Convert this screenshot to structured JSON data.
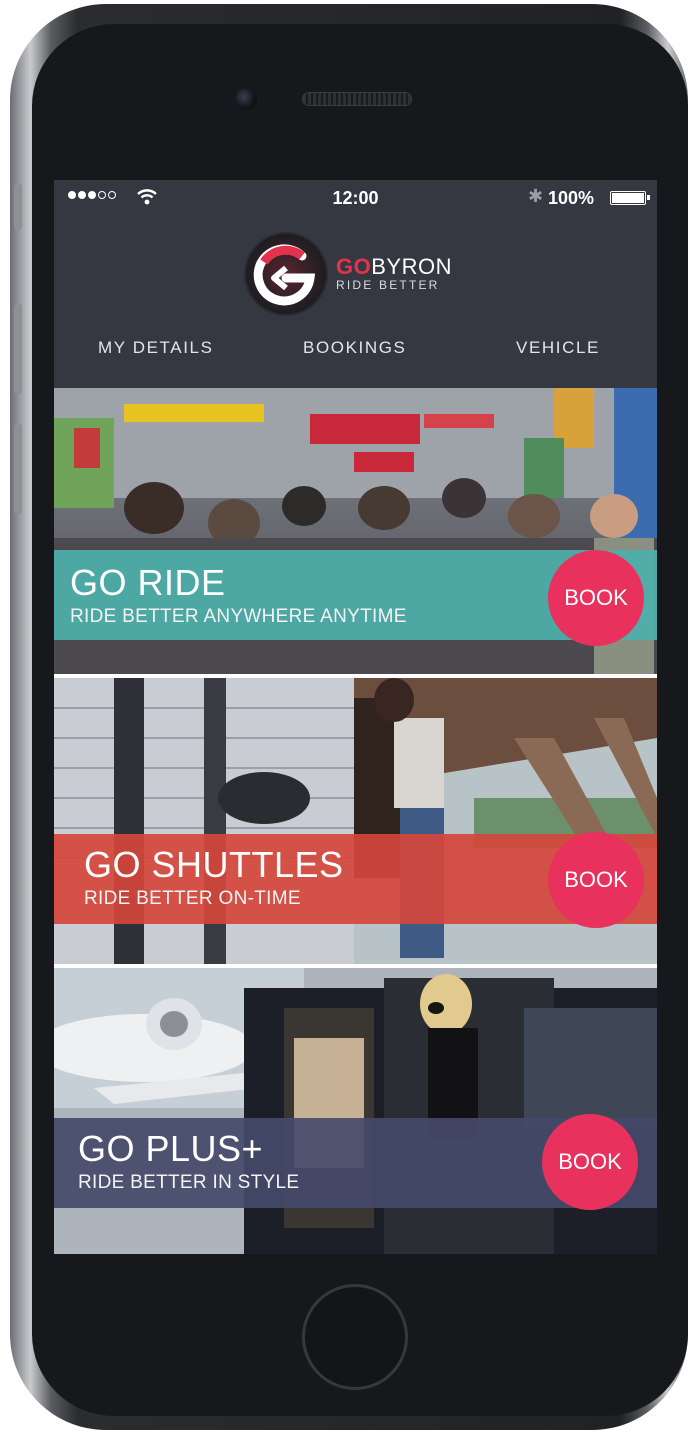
{
  "status_bar": {
    "signal_dots": [
      true,
      true,
      true,
      false,
      false
    ],
    "time": "12:00",
    "bluetooth_icon": "bluetooth-icon",
    "battery": "100%"
  },
  "brand": {
    "name_go": "GO",
    "name_rest": "BYRON",
    "tagline": "RIDE BETTER",
    "accent_color": "#e2334a"
  },
  "nav": {
    "items": [
      "MY DETAILS",
      "BOOKINGS",
      "VEHICLE"
    ]
  },
  "services": [
    {
      "title": "GO RIDE",
      "subtitle": "RIDE BETTER ANYWHERE ANYTIME",
      "book_label": "BOOK",
      "band_color": "#4db0ab",
      "photo": "crowded shopping street"
    },
    {
      "title": "GO SHUTTLES",
      "subtitle": "RIDE BETTER ON-TIME",
      "book_label": "BOOK",
      "band_color": "#d5473c",
      "photo": "couple hugging with luggage at terminal"
    },
    {
      "title": "GO PLUS+",
      "subtitle": "RIDE BETTER IN STYLE",
      "book_label": "BOOK",
      "band_color": "#454a6a",
      "photo": "woman stepping out of luxury car near private jet"
    }
  ],
  "colors": {
    "screen_background": "#363841",
    "book_button": "#e8315d"
  }
}
